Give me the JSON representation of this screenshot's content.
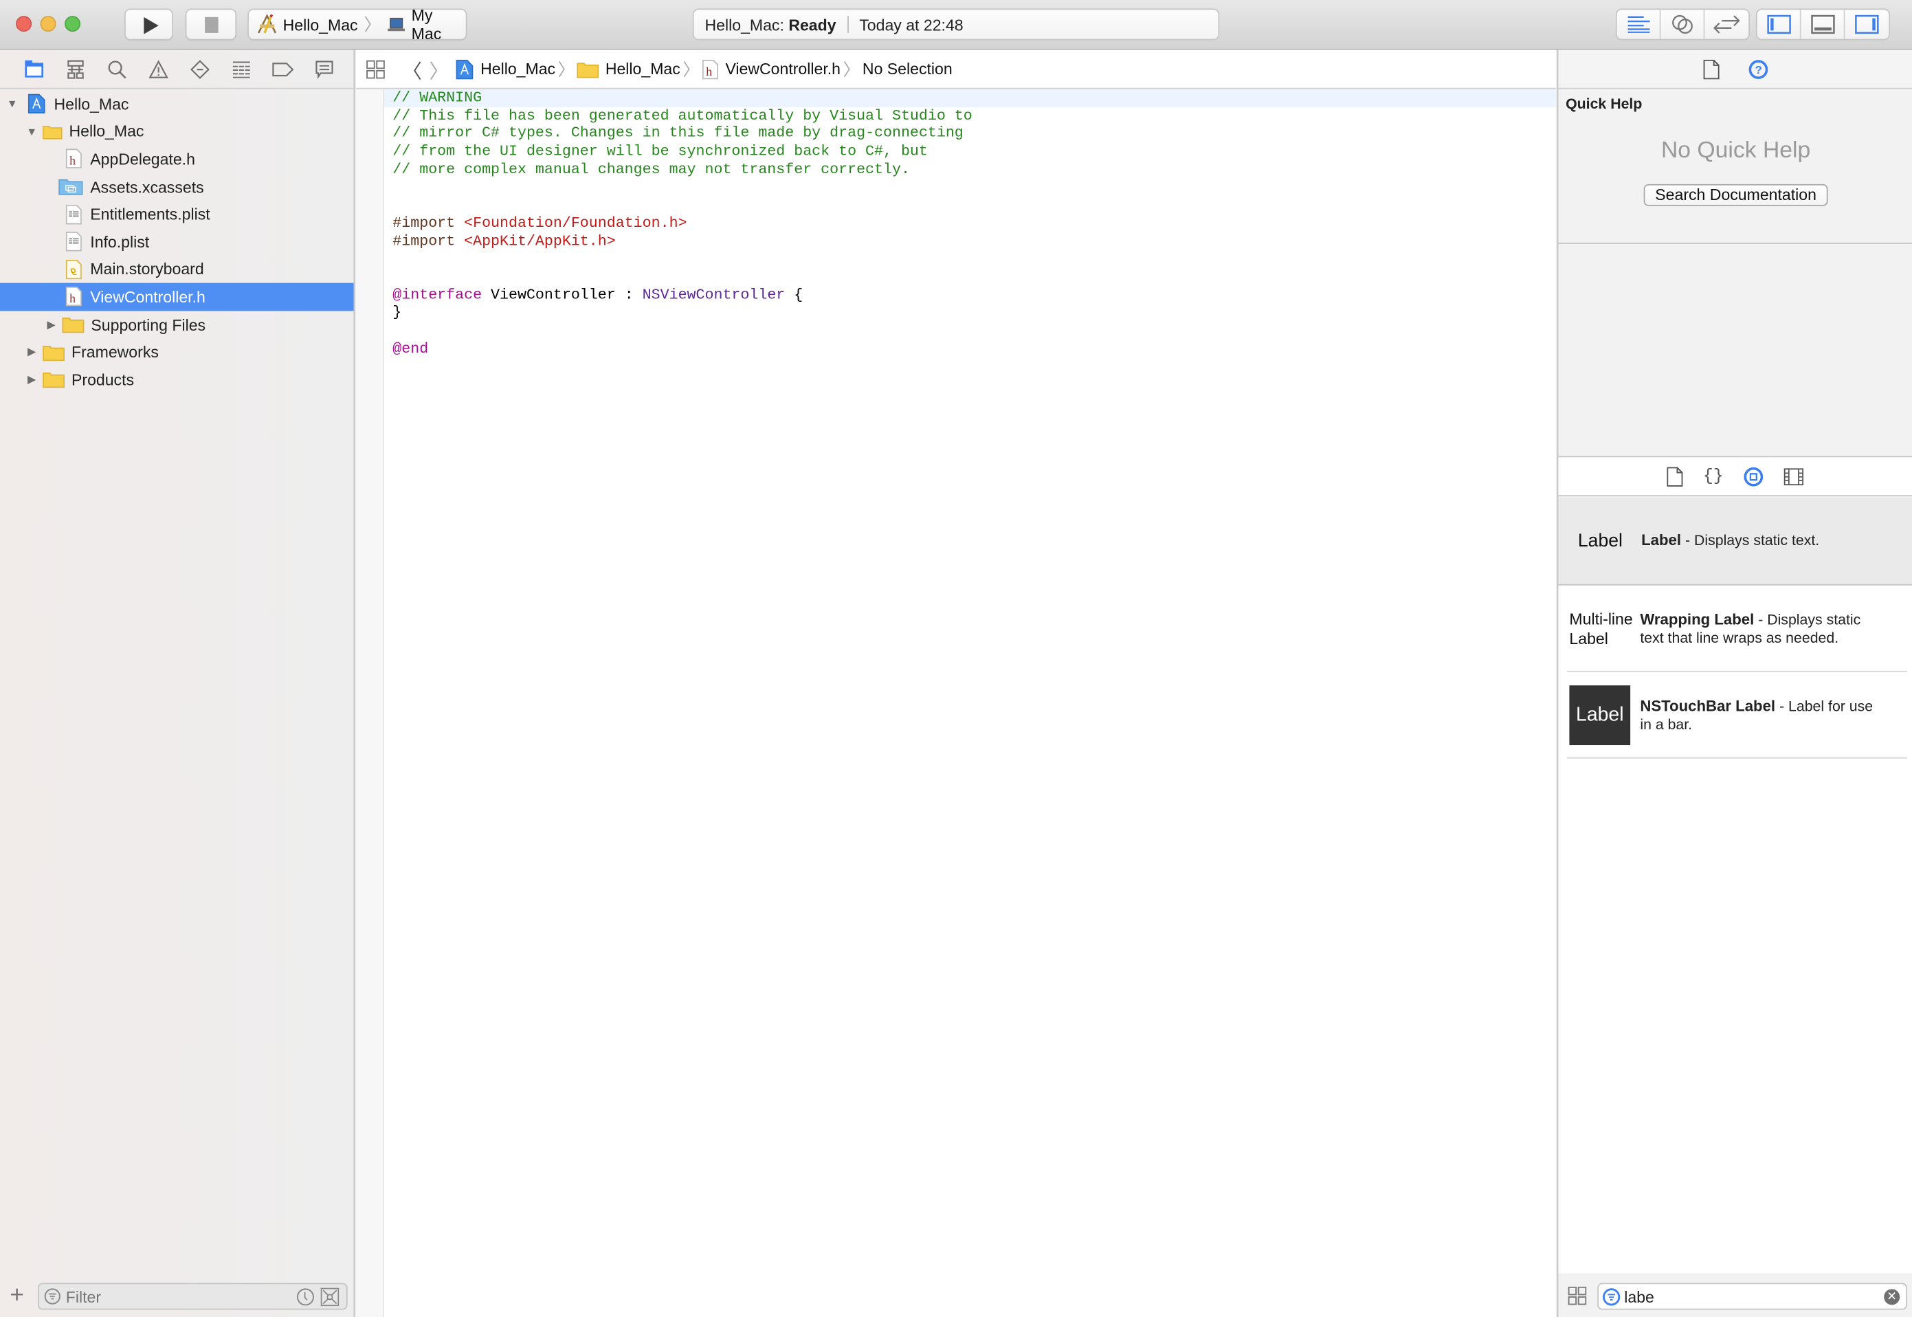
{
  "toolbar": {
    "scheme": {
      "project": "Hello_Mac",
      "destination": "My Mac"
    },
    "status": {
      "project_label": "Hello_Mac:",
      "state": "Ready",
      "timestamp": "Today at 22:48"
    },
    "buttons": {
      "run": "run-icon",
      "stop": "stop-icon",
      "editor_modes": [
        "standard-editor-icon",
        "assistant-editor-icon",
        "version-editor-icon"
      ],
      "panel_toggles": [
        "navigator-panel-icon",
        "debug-area-icon",
        "utilities-panel-icon"
      ]
    }
  },
  "navigator": {
    "tabs": [
      "project-navigator",
      "symbol-navigator",
      "find-navigator",
      "issue-navigator",
      "test-navigator",
      "debug-navigator",
      "breakpoint-navigator",
      "report-navigator"
    ],
    "tree": [
      {
        "label": "Hello_Mac",
        "type": "project",
        "level": 0,
        "expanded": true
      },
      {
        "label": "Hello_Mac",
        "type": "folder",
        "level": 1,
        "expanded": true
      },
      {
        "label": "AppDelegate.h",
        "type": "header",
        "level": 2
      },
      {
        "label": "Assets.xcassets",
        "type": "assets",
        "level": 2
      },
      {
        "label": "Entitlements.plist",
        "type": "plist",
        "level": 2
      },
      {
        "label": "Info.plist",
        "type": "plist",
        "level": 2
      },
      {
        "label": "Main.storyboard",
        "type": "storyboard",
        "level": 2
      },
      {
        "label": "ViewController.h",
        "type": "header",
        "level": 2,
        "selected": true
      },
      {
        "label": "Supporting Files",
        "type": "folder",
        "level": 2,
        "expanded": false
      },
      {
        "label": "Frameworks",
        "type": "folder",
        "level": 1,
        "expanded": false
      },
      {
        "label": "Products",
        "type": "folder",
        "level": 1,
        "expanded": false
      }
    ],
    "filter": {
      "placeholder": "Filter",
      "value": ""
    }
  },
  "jumpbar": {
    "crumbs": [
      "Hello_Mac",
      "Hello_Mac",
      "ViewController.h",
      "No Selection"
    ]
  },
  "editor": {
    "lines": [
      [
        {
          "t": "// WARNING",
          "c": "comment"
        }
      ],
      [
        {
          "t": "// This file has been generated automatically by Visual Studio to",
          "c": "comment"
        }
      ],
      [
        {
          "t": "// mirror C# types. Changes in this file made by drag-connecting",
          "c": "comment"
        }
      ],
      [
        {
          "t": "// from the UI designer will be synchronized back to C#, but",
          "c": "comment"
        }
      ],
      [
        {
          "t": "// more complex manual changes may not transfer correctly.",
          "c": "comment"
        }
      ],
      [],
      [],
      [
        {
          "t": "#import ",
          "c": "pre"
        },
        {
          "t": "<Foundation/Foundation.h>",
          "c": "str"
        }
      ],
      [
        {
          "t": "#import ",
          "c": "pre"
        },
        {
          "t": "<AppKit/AppKit.h>",
          "c": "str"
        }
      ],
      [],
      [],
      [
        {
          "t": "@interface",
          "c": "kw"
        },
        {
          "t": " ViewController : ",
          "c": "plain"
        },
        {
          "t": "NSViewController",
          "c": "type"
        },
        {
          "t": " {",
          "c": "plain"
        }
      ],
      [
        {
          "t": "}",
          "c": "plain"
        }
      ],
      [],
      [
        {
          "t": "@end",
          "c": "kw"
        }
      ]
    ]
  },
  "inspector": {
    "tabs": [
      "file-inspector",
      "quick-help-inspector"
    ],
    "quick_help": {
      "title": "Quick Help",
      "empty_message": "No Quick Help",
      "search_button": "Search Documentation"
    },
    "library_tabs": [
      "file-template-library",
      "code-snippet-library",
      "object-library",
      "media-library"
    ],
    "library_items": [
      {
        "thumb": "Label",
        "name": "Label",
        "desc": " - Displays static text."
      },
      {
        "thumb": "Multi-line Label",
        "name": "Wrapping Label",
        "desc": " - Displays static text that line wraps as needed."
      },
      {
        "thumb": "Label",
        "name": "NSTouchBar Label",
        "desc": " - Label for use in a bar."
      }
    ],
    "search": {
      "value": "labe"
    }
  },
  "colors": {
    "accent": "#3b7ff0",
    "selection": "#4f8ef2",
    "comment": "#26871d",
    "string": "#c41a16",
    "keyword": "#aa0d91",
    "type": "#5c2699"
  }
}
